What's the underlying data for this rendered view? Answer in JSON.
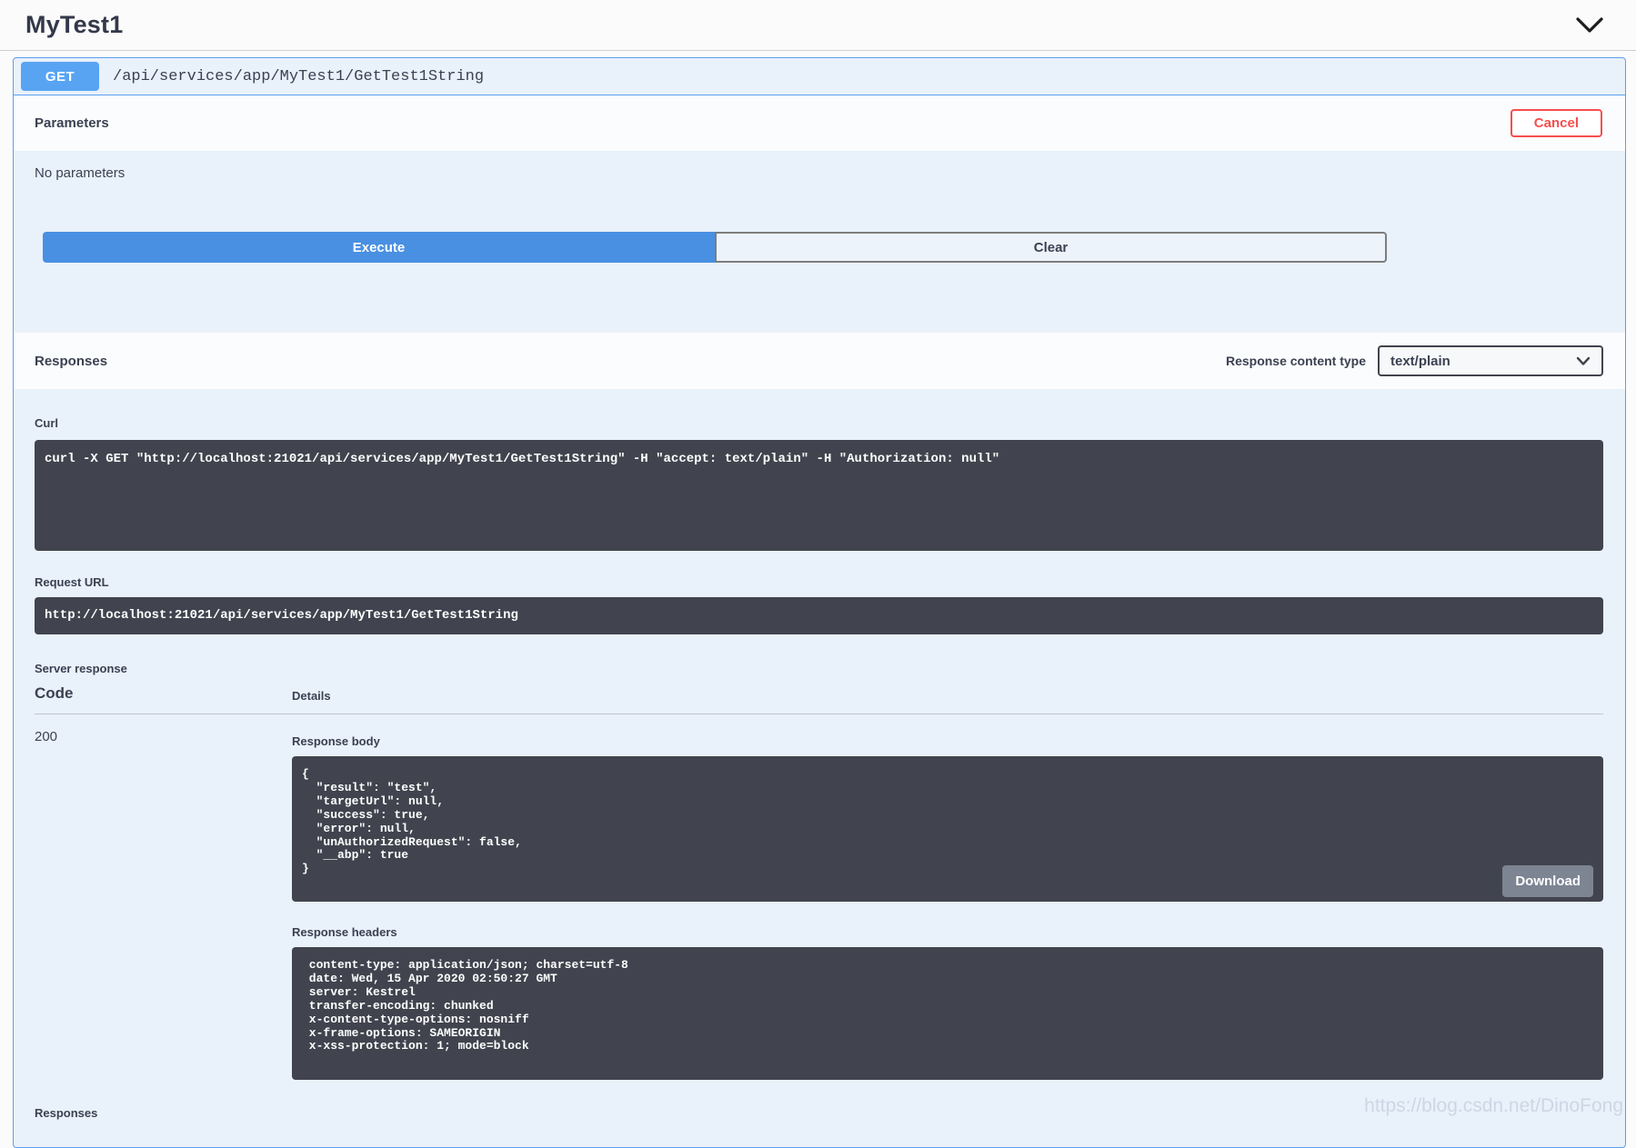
{
  "header": {
    "title": "MyTest1"
  },
  "operation": {
    "method": "GET",
    "path": "/api/services/app/MyTest1/GetTest1String"
  },
  "parameters": {
    "title": "Parameters",
    "cancel_label": "Cancel",
    "empty_text": "No parameters",
    "execute_label": "Execute",
    "clear_label": "Clear"
  },
  "responses": {
    "title": "Responses",
    "content_type_label": "Response content type",
    "content_type_value": "text/plain",
    "curl_label": "Curl",
    "curl_command": "curl -X GET \"http://localhost:21021/api/services/app/MyTest1/GetTest1String\" -H \"accept: text/plain\" -H \"Authorization: null\"",
    "request_url_label": "Request URL",
    "request_url": "http://localhost:21021/api/services/app/MyTest1/GetTest1String",
    "server_response_label": "Server response",
    "code_header": "Code",
    "details_header": "Details",
    "status_code": "200",
    "response_body_label": "Response body",
    "response_body": "{\n  \"result\": \"test\",\n  \"targetUrl\": null,\n  \"success\": true,\n  \"error\": null,\n  \"unAuthorizedRequest\": false,\n  \"__abp\": true\n}",
    "download_label": "Download",
    "response_headers_label": "Response headers",
    "response_headers": " content-type: application/json; charset=utf-8 \n date: Wed, 15 Apr 2020 02:50:27 GMT \n server: Kestrel \n transfer-encoding: chunked \n x-content-type-options: nosniff \n x-frame-options: SAMEORIGIN \n x-xss-protection: 1; mode=block ",
    "bottom_section_label": "Responses"
  },
  "icons": {
    "collapse": "chevron-down",
    "select_arrow": "chevron-down"
  },
  "colors": {
    "accent_blue": "#58a4f2",
    "execute_blue": "#4990e2",
    "cancel_red": "#f64e4e",
    "dark_block": "#41444e",
    "opblock_bg": "#e9f1fb",
    "opblock_border": "#5b9ef0",
    "text": "#3b4151"
  },
  "watermark": "https://blog.csdn.net/DinoFong"
}
